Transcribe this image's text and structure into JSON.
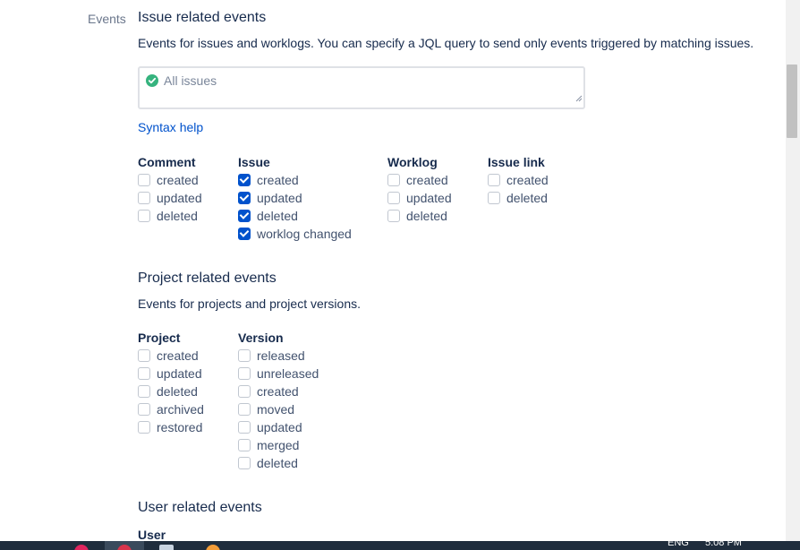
{
  "side_label": "Events",
  "issue_section": {
    "title": "Issue related events",
    "description": "Events for issues and worklogs. You can specify a JQL query to send only events triggered by matching issues.",
    "jql_placeholder": "All issues",
    "syntax_help": "Syntax help",
    "columns": [
      {
        "heading": "Comment",
        "items": [
          {
            "label": "created",
            "checked": false
          },
          {
            "label": "updated",
            "checked": false
          },
          {
            "label": "deleted",
            "checked": false
          }
        ]
      },
      {
        "heading": "Issue",
        "items": [
          {
            "label": "created",
            "checked": true
          },
          {
            "label": "updated",
            "checked": true
          },
          {
            "label": "deleted",
            "checked": true
          },
          {
            "label": "worklog changed",
            "checked": true
          }
        ]
      },
      {
        "heading": "Worklog",
        "items": [
          {
            "label": "created",
            "checked": false
          },
          {
            "label": "updated",
            "checked": false
          },
          {
            "label": "deleted",
            "checked": false
          }
        ]
      },
      {
        "heading": "Issue link",
        "items": [
          {
            "label": "created",
            "checked": false
          },
          {
            "label": "deleted",
            "checked": false
          }
        ]
      }
    ]
  },
  "project_section": {
    "title": "Project related events",
    "description": "Events for projects and project versions.",
    "columns": [
      {
        "heading": "Project",
        "items": [
          {
            "label": "created",
            "checked": false
          },
          {
            "label": "updated",
            "checked": false
          },
          {
            "label": "deleted",
            "checked": false
          },
          {
            "label": "archived",
            "checked": false
          },
          {
            "label": "restored",
            "checked": false
          }
        ]
      },
      {
        "heading": "Version",
        "items": [
          {
            "label": "released",
            "checked": false
          },
          {
            "label": "unreleased",
            "checked": false
          },
          {
            "label": "created",
            "checked": false
          },
          {
            "label": "moved",
            "checked": false
          },
          {
            "label": "updated",
            "checked": false
          },
          {
            "label": "merged",
            "checked": false
          },
          {
            "label": "deleted",
            "checked": false
          }
        ]
      }
    ]
  },
  "user_section": {
    "title": "User related events",
    "columns": [
      {
        "heading": "User",
        "items": []
      }
    ]
  },
  "taskbar": {
    "language": "ENG",
    "time": "5:08 PM"
  },
  "colors": {
    "accent": "#0052cc",
    "success": "#36b37e",
    "text": "#172b4d",
    "muted": "#6b778c"
  }
}
